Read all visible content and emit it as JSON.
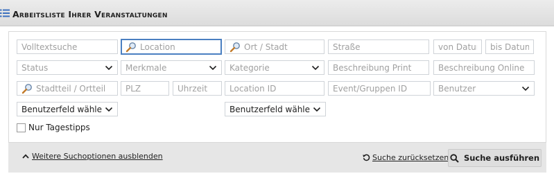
{
  "header": {
    "title": "Arbeitsliste Ihrer Veranstaltungen",
    "icon": "list-icon"
  },
  "fields": {
    "volltext": {
      "placeholder": "Volltextsuche"
    },
    "location": {
      "placeholder": "Location",
      "icon": "magnifier-icon"
    },
    "ort": {
      "placeholder": "Ort / Stadt",
      "icon": "magnifier-icon"
    },
    "strasse": {
      "placeholder": "Straße"
    },
    "von_datum": {
      "placeholder": "von Datum"
    },
    "bis_datum": {
      "placeholder": "bis Datum"
    },
    "status": {
      "value": "Status"
    },
    "merkmale": {
      "value": "Merkmale"
    },
    "kategorie": {
      "value": "Kategorie"
    },
    "beschreibung_print": {
      "placeholder": "Beschreibung Print"
    },
    "beschreibung_online": {
      "placeholder": "Beschreibung Online"
    },
    "stadtteil": {
      "placeholder": "Stadtteil / Ortteil",
      "icon": "magnifier-icon"
    },
    "plz": {
      "placeholder": "PLZ"
    },
    "uhrzeit": {
      "placeholder": "Uhrzeit"
    },
    "location_id": {
      "placeholder": "Location ID"
    },
    "event_id": {
      "placeholder": "Event/Gruppen ID"
    },
    "benutzer": {
      "value": "Benutzer"
    },
    "benutzerfeld_1": {
      "value": "Benutzerfeld wählen"
    },
    "benutzerfeld_2": {
      "value": "Benutzerfeld wählen"
    }
  },
  "checkbox": {
    "label": "Nur Tagestipps",
    "checked": false
  },
  "footer": {
    "toggle_label": "Weitere Suchoptionen ausblenden",
    "reset_label": "Suche zurücksetzen",
    "search_label": "Suche ausführen"
  },
  "colors": {
    "accent": "#4a7fc1",
    "icon_blue": "#3a6fbf",
    "footer_bg": "#e6e6e6"
  }
}
